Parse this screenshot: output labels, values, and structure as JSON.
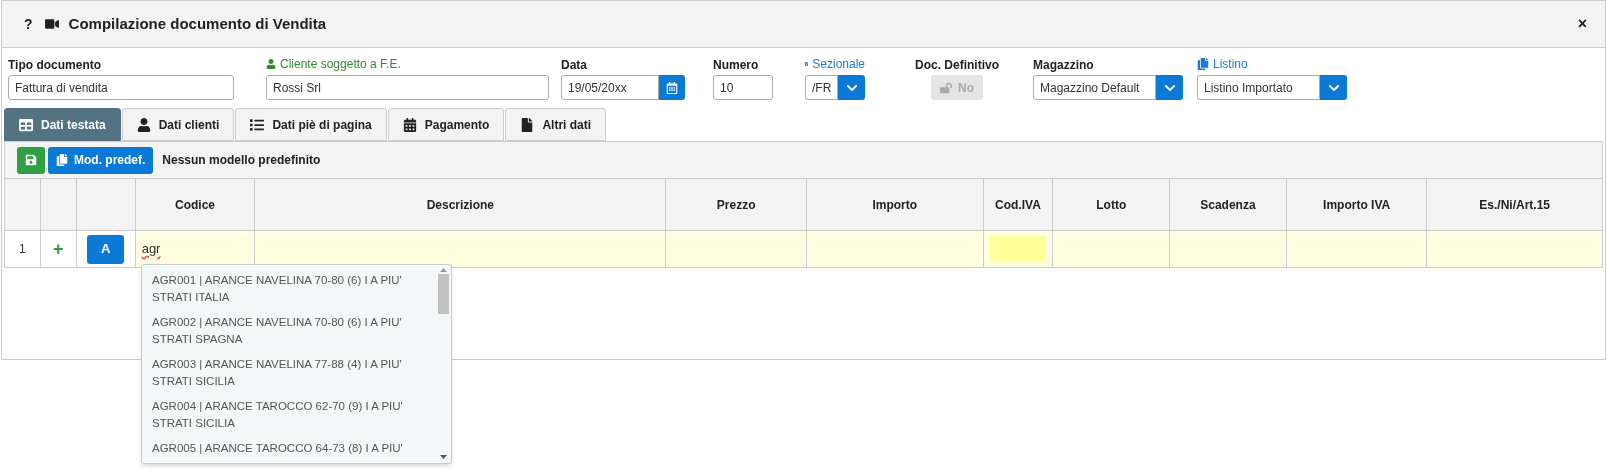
{
  "window": {
    "title": "Compilazione documento di Vendita",
    "help": "?",
    "close": "×"
  },
  "fields": [
    {
      "kind": "text",
      "label": "Tipo documento",
      "value": "Fattura di vendita"
    },
    {
      "kind": "text",
      "label": "Cliente soggetto a F.E.",
      "value": "Rossi Srl"
    },
    {
      "kind": "date",
      "label": "Data",
      "value": "19/05/20xx"
    },
    {
      "kind": "text",
      "label": "Numero",
      "value": "10"
    },
    {
      "kind": "select",
      "label": "Sezionale",
      "value": "/FR"
    },
    {
      "kind": "toggle",
      "label": "Doc. Definitivo",
      "value": "No",
      "disabled": true
    },
    {
      "kind": "select",
      "label": "Magazzino",
      "value": "Magazzino Default"
    },
    {
      "kind": "select",
      "label": "Listino",
      "value": "Listino Importato"
    }
  ],
  "tabs": [
    {
      "label": "Dati testata",
      "selected": true
    },
    {
      "label": "Dati clienti",
      "selected": false
    },
    {
      "label": "Dati piè di pagina",
      "selected": false
    },
    {
      "label": "Pagamento",
      "selected": false
    },
    {
      "label": "Altri dati",
      "selected": false
    }
  ],
  "toolbar": {
    "template_button": "Mod. predef.",
    "template_status": "Nessun modello predefinito"
  },
  "table": {
    "columns": [
      "Codice",
      "Descrizione",
      "Prezzo",
      "Importo",
      "Cod.IVA",
      "Lotto",
      "Scadenza",
      "Importo IVA",
      "Es./Ni/Art.15"
    ],
    "rows": [
      {
        "number": "1",
        "add": "+",
        "mode": "A",
        "codice": "agr"
      }
    ]
  },
  "suggestions": [
    "AGR001 | ARANCE NAVELINA 70-80 (6) I A PIU' STRATI ITALIA",
    "AGR002 | ARANCE NAVELINA 70-80 (6) I A PIU' STRATI SPAGNA",
    "AGR003 | ARANCE NAVELINA 77-88 (4) I A PIU' STRATI SICILIA",
    "AGR004 | ARANCE TAROCCO 62-70 (9) I A PIU' STRATI SICILIA",
    "AGR005 | ARANCE TAROCCO 64-73 (8) I A PIU'"
  ]
}
